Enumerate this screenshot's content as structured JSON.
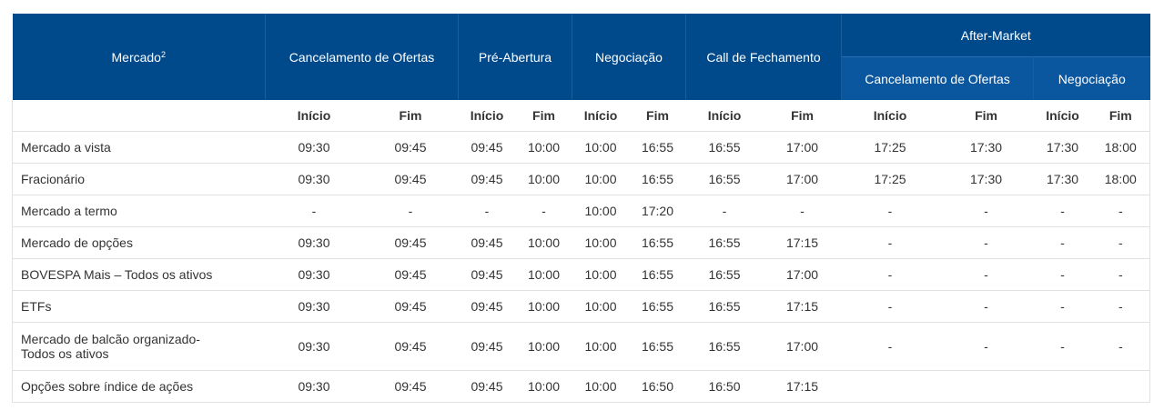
{
  "header": {
    "mercado": "Mercado",
    "mercado_sup": "2",
    "cancelamento": "Cancelamento de Ofertas",
    "pre_abertura": "Pré-Abertura",
    "negociacao": "Negociação",
    "call": "Call de Fechamento",
    "after_market": "After-Market",
    "after_cancelamento": "Cancelamento de Ofertas",
    "after_negociacao": "Negociação"
  },
  "subheader": [
    "Início",
    "Fim",
    "Início",
    "Fim",
    "Início",
    "Fim",
    "Início",
    "Fim",
    "Início",
    "Fim",
    "Início",
    "Fim"
  ],
  "rows": [
    {
      "name": "Mercado a vista",
      "cells": [
        "09:30",
        "09:45",
        "09:45",
        "10:00",
        "10:00",
        "16:55",
        "16:55",
        "17:00",
        "17:25",
        "17:30",
        "17:30",
        "18:00"
      ]
    },
    {
      "name": "Fracionário",
      "cells": [
        "09:30",
        "09:45",
        "09:45",
        "10:00",
        "10:00",
        "16:55",
        "16:55",
        "17:00",
        "17:25",
        "17:30",
        "17:30",
        "18:00"
      ]
    },
    {
      "name": "Mercado a termo",
      "cells": [
        "-",
        "-",
        "-",
        "-",
        "10:00",
        "17:20",
        "-",
        "-",
        "-",
        "-",
        "-",
        "-"
      ]
    },
    {
      "name": "Mercado de opções",
      "cells": [
        "09:30",
        "09:45",
        "09:45",
        "10:00",
        "10:00",
        "16:55",
        "16:55",
        "17:15",
        "-",
        "-",
        "-",
        "-"
      ]
    },
    {
      "name": "BOVESPA Mais – Todos os ativos",
      "cells": [
        "09:30",
        "09:45",
        "09:45",
        "10:00",
        "10:00",
        "16:55",
        "16:55",
        "17:00",
        "-",
        "-",
        "-",
        "-"
      ]
    },
    {
      "name": "ETFs",
      "cells": [
        "09:30",
        "09:45",
        "09:45",
        "10:00",
        "10:00",
        "16:55",
        "16:55",
        "17:15",
        "-",
        "-",
        "-",
        "-"
      ]
    },
    {
      "name_line1": "Mercado de balcão organizado-",
      "name_line2": "Todos os ativos",
      "cells": [
        "09:30",
        "09:45",
        "09:45",
        "10:00",
        "10:00",
        "16:55",
        "16:55",
        "17:00",
        "-",
        "-",
        "-",
        "-"
      ]
    },
    {
      "name": "Opções sobre índice de ações",
      "cells": [
        "09:30",
        "09:45",
        "09:45",
        "10:00",
        "10:00",
        "16:50",
        "16:50",
        "17:15",
        "",
        "",
        "",
        ""
      ]
    }
  ]
}
